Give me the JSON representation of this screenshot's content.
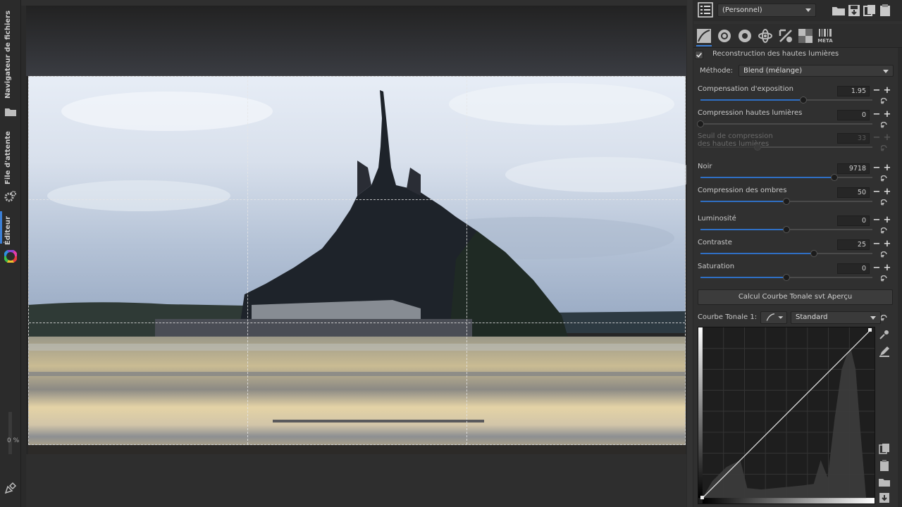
{
  "left_tabs": {
    "file_browser": "Navigateur de fichiers",
    "queue": "File d'attente",
    "editor": "Éditeur",
    "zoom_percent": "0 %"
  },
  "right_panel": {
    "profile": {
      "value": "(Personnel)"
    },
    "tabs": [
      "exposure-tab",
      "detail-tab",
      "color-tab",
      "advanced-tab",
      "transform-tab",
      "raw-tab",
      "meta-tab"
    ],
    "meta_tab_label": "META",
    "highlight_reconstruction": {
      "label": "Reconstruction des hautes lumières",
      "checked": true
    },
    "method": {
      "label": "Méthode:",
      "value": "Blend (mélange)"
    },
    "sliders": [
      {
        "label": "Compensation d'exposition",
        "value": "1.95",
        "fraction": 0.6
      },
      {
        "label": "Compression hautes lumières",
        "value": "0",
        "fraction": 0.0
      },
      {
        "label_line1": "Seuil de compression",
        "label_line2": "des hautes lumières",
        "value": "33",
        "fraction": 0.33,
        "disabled": true
      },
      {
        "label": "Noir",
        "value": "9718",
        "fraction": 0.78
      },
      {
        "label": "Compression des ombres",
        "value": "50",
        "fraction": 0.5
      },
      {
        "label": "Luminosité",
        "value": "0",
        "fraction": 0.5
      },
      {
        "label": "Contraste",
        "value": "25",
        "fraction": 0.66
      },
      {
        "label": "Saturation",
        "value": "0",
        "fraction": 0.5
      }
    ],
    "auto_curve_button": "Calcul Courbe Tonale svt Aperçu",
    "tone_curve": {
      "label": "Courbe Tonale 1:",
      "mode": "Standard"
    }
  },
  "colors": {
    "accent": "#2f6fc4",
    "panel_bg": "#303030"
  }
}
